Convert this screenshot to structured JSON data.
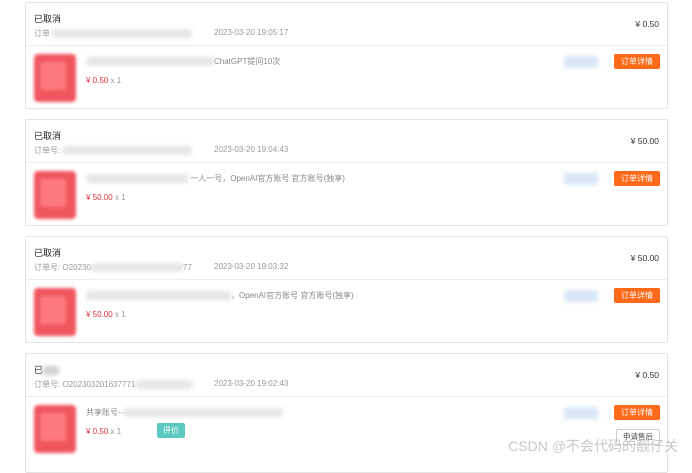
{
  "orders": [
    {
      "status": "已取消",
      "order_prefix": "订单",
      "order_suffix": "",
      "time": "2023-03-20 19:05:17",
      "total": "¥ 0.50",
      "product_name": "ChatGPT提问10次",
      "unit_price": "¥ 0.50",
      "quantity": "x 1",
      "detail_button": "订单详情"
    },
    {
      "status": "已取消",
      "order_prefix": "订单号:",
      "order_suffix": "",
      "time": "2023-03-20 19:04:43",
      "total": "¥ 50.00",
      "product_name": "一人一号，OpenAI官方账号 官方账号(独享)",
      "unit_price": "¥ 50.00",
      "quantity": "x 1",
      "detail_button": "订单详情"
    },
    {
      "status": "已取消",
      "order_prefix": "订单号: O20230",
      "order_suffix": "77",
      "time": "2023-03-20 19:03:32",
      "total": "¥ 50.00",
      "product_name": "，OpenAI官方账号 官方账号(独享)",
      "unit_price": "¥ 50.00",
      "quantity": "x 1",
      "detail_button": "订单详情"
    },
    {
      "status": "已",
      "order_prefix": "订单号: O202303201637771",
      "order_suffix": "",
      "time": "2023-03-20 19:02:43",
      "total": "¥ 0.50",
      "product_name": "共享账号--",
      "unit_price": "¥ 0.50",
      "quantity": "x 1",
      "detail_button": "订单详情",
      "review_button": "评价",
      "after_sale_button": "申请售后"
    }
  ],
  "watermark": "CSDN @不会代码的靓仔关",
  "colors": {
    "accent": "#ff6a1a",
    "price": "#e0313b",
    "review": "#5cc9c0"
  }
}
